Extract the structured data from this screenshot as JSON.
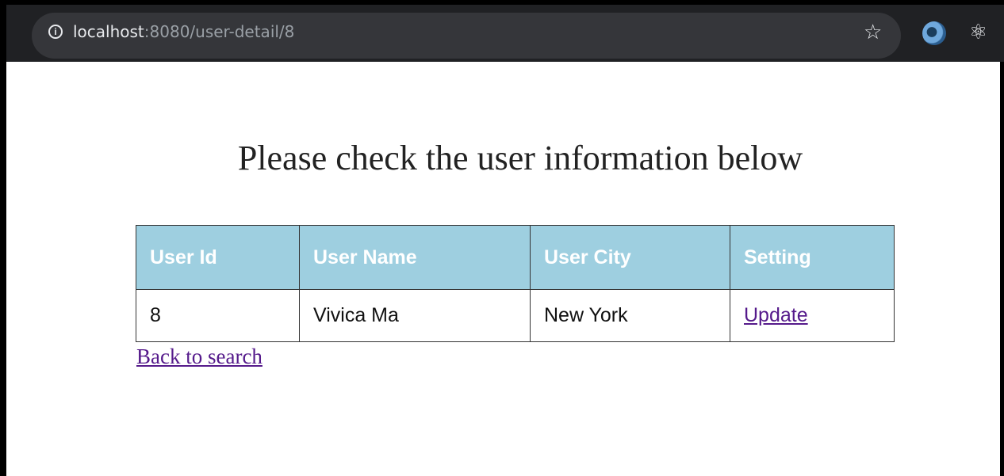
{
  "browser": {
    "url_host": "localhost",
    "url_rest": ":8080/user-detail/8",
    "icons": [
      "info-icon",
      "star-icon",
      "extension-icon",
      "react-devtools-icon"
    ]
  },
  "page": {
    "heading": "Please check the user information below",
    "table": {
      "headers": [
        "User Id",
        "User Name",
        "User City",
        "Setting"
      ],
      "rows": [
        {
          "id": "8",
          "name": "Vivica Ma",
          "city": "New York",
          "setting_link": "Update"
        }
      ]
    },
    "back_link": "Back to search"
  },
  "colors": {
    "header_bg": "#9ecfe0",
    "link": "#551a8b"
  }
}
